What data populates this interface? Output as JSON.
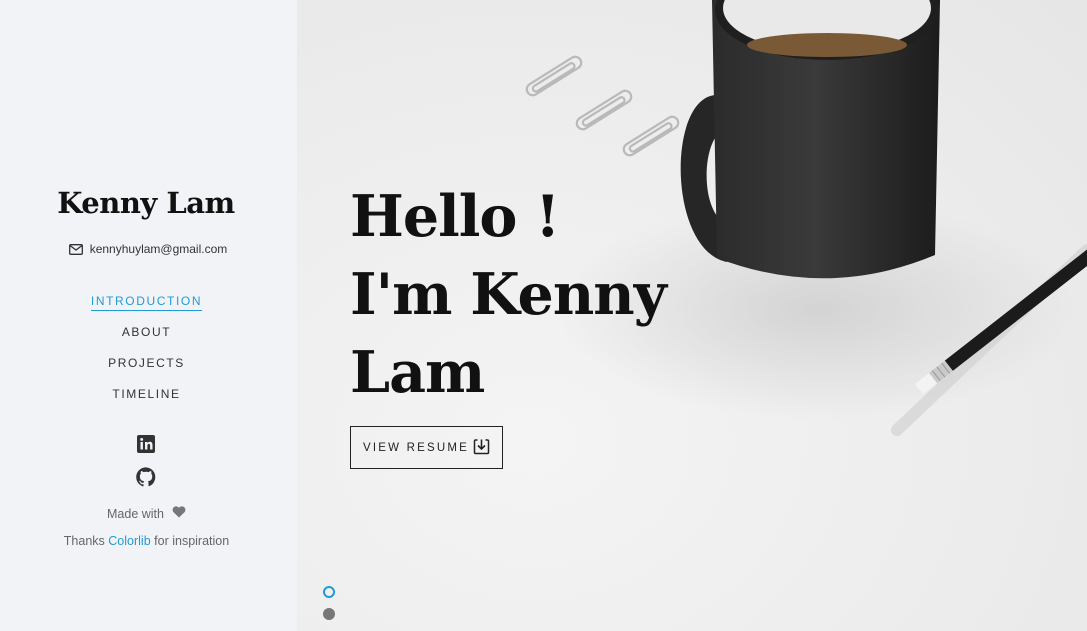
{
  "sidebar": {
    "name": "Kenny Lam",
    "email": "kennyhuylam@gmail.com",
    "nav": [
      {
        "label": "INTRODUCTION",
        "active": true
      },
      {
        "label": "ABOUT",
        "active": false
      },
      {
        "label": "PROJECTS",
        "active": false
      },
      {
        "label": "TIMELINE",
        "active": false
      }
    ],
    "social_icons": [
      "linkedin-icon",
      "github-icon"
    ],
    "made_with": "Made with",
    "made_with_icon": "heart-icon",
    "thanks_prefix": "Thanks",
    "thanks_link": "Colorlib",
    "thanks_suffix": "for inspiration"
  },
  "hero": {
    "headline": [
      "Hello !",
      "I'm Kenny",
      "Lam"
    ],
    "resume_button": "VIEW RESUME",
    "resume_icon": "download-icon",
    "slides": [
      {
        "active": true
      },
      {
        "active": false
      }
    ]
  },
  "colors": {
    "accent": "#1f9bd8",
    "sidebar_bg": "#f2f3f7",
    "text_dark": "#111111"
  }
}
